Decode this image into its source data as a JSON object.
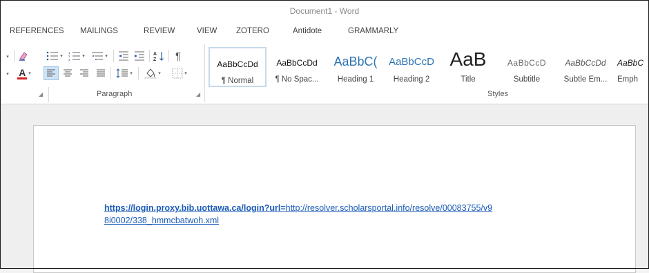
{
  "window": {
    "title": "Document1 - Word"
  },
  "ribbon_tabs": [
    {
      "label": "REFERENCES"
    },
    {
      "label": "MAILINGS"
    },
    {
      "label": "REVIEW"
    },
    {
      "label": "VIEW"
    },
    {
      "label": "ZOTERO"
    },
    {
      "label": "Antidote"
    },
    {
      "label": "GRAMMARLY"
    }
  ],
  "paragraph_group": {
    "label": "Paragraph",
    "icons": [
      "bullets-icon",
      "numbering-icon",
      "multilevel-list-icon",
      "decrease-indent-icon",
      "increase-indent-icon",
      "sort-icon",
      "show-marks-icon",
      "align-left-icon",
      "center-icon",
      "align-right-icon",
      "justify-icon",
      "line-spacing-icon",
      "shading-icon",
      "borders-icon"
    ],
    "sort_glyph": "A↓Z",
    "pilcrow": "¶"
  },
  "font_group": {
    "font_color": "#d32020",
    "highlight_color": "#c94bd0",
    "font_color_letter": "A"
  },
  "styles_group": {
    "label": "Styles",
    "styles": [
      {
        "sample": "AaBbCcDd",
        "name": "¶ Normal"
      },
      {
        "sample": "AaBbCcDd",
        "name": "¶ No Spac..."
      },
      {
        "sample": "AaBbC(",
        "name": "Heading 1"
      },
      {
        "sample": "AaBbCcD",
        "name": "Heading 2"
      },
      {
        "sample": "AaB",
        "name": "Title"
      },
      {
        "sample": "AaBbCcD",
        "name": "Subtitle"
      },
      {
        "sample": "AaBbCcDd",
        "name": "Subtle Em..."
      },
      {
        "sample": "AaBbC",
        "name": "Emph"
      }
    ]
  },
  "document": {
    "link_bold": "https://login.proxy.bib.uottawa.ca/login?url=",
    "link_rest_line1": "http://resolver.scholarsportal.info/resolve/00083755/v9",
    "link_line2": "8i0002/338_hmmcbatwoh.xml"
  },
  "colors": {
    "accent": "#2b579a",
    "link": "#1a5bb8",
    "heading_style": "#2e74b5"
  }
}
